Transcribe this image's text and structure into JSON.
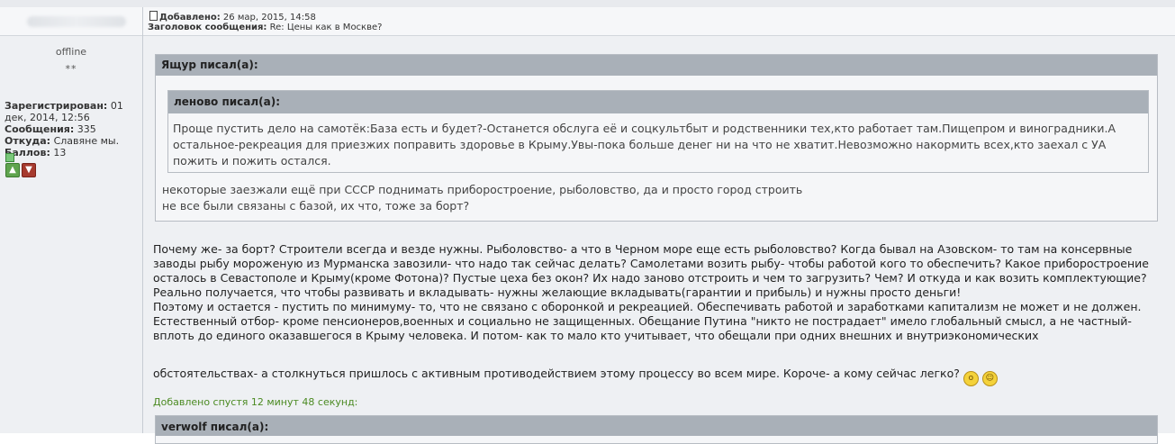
{
  "author": {
    "status": "offline",
    "rank_stars": "**",
    "registered_label": "Зарегистрирован:",
    "registered_value": "01 дек, 2014, 12:56",
    "posts_label": "Сообщения:",
    "posts_value": "335",
    "from_label": "Откуда:",
    "from_value": "Славяне мы.",
    "points_label": "Баллов:",
    "points_value": "13"
  },
  "post": {
    "added_label": "Добавлено:",
    "added_value": "26 мар, 2015, 14:58",
    "subject_label": "Заголовок сообщения:",
    "subject_value": "Re: Цены как в Москве?",
    "quote_outer": {
      "header": "Ящур писал(а):",
      "lines": [
        "некоторые заезжали ещё при СССР поднимать приборостроение, рыболовство, да и просто город строить",
        "не все были связаны с базой, их что, тоже за борт?"
      ]
    },
    "quote_inner": {
      "header": "леново писал(а):",
      "text": "Проще пустить дело на самотёк:База есть и будет?-Останется обслуга её и соцкультбыт и родственники тех,кто работает там.Пищепром и виноградники.А остальное-рекреация для приезжих поправить здоровье в Крыму.Увы-пока больше денег ни на что не хватит.Невозможно накормить всех,кто заехал с УА пожить и пожить остался."
    },
    "body_lines": [
      "Почему же- за борт? Строители всегда и везде нужны. Рыболовство- а что в Черном море еще есть рыболовство? Когда бывал на Азовском- то там на консервные заводы рыбу мороженую из Мурманска завозили- что надо так сейчас делать? Самолетами возить рыбу- чтобы работой кого то обеспечить? Какое приборостроение осталось в Севастополе и Крыму(кроме Фотона)? Пустые цеха без окон? Их надо заново отстроить и чем то загрузить? Чем? И откуда и как возить комплектующие?",
      "Реально получается, что чтобы развивать и вкладывать- нужны желающие вкладывать(гарантии и прибыль) и нужны просто деньги!",
      "Поэтому и остается - пустить по минимуму- то, что не связано с оборонкой и рекреацией. Обеспечивать работой и заработками капитализм не может и не должен. Естественный отбор- кроме пенсионеров,военных и социально не защищенных. Обещание Путина \"никто не пострадает\" имело глобальный смысл, а не частный- вплоть до единого оказавшегося в Крыму человека. И потом- как то мало кто учитывает, что обещали при одних внешних и внутриэкономических"
    ],
    "last_line": "обстоятельствах- а столкнуться пришлось с активным противодействием этому процессу во всем мире. Короче- а кому сейчас легко?",
    "added_later": "Добавлено спустя 12 минут 48 секунд:",
    "next_quote_header": "verwolf писал(а):"
  }
}
